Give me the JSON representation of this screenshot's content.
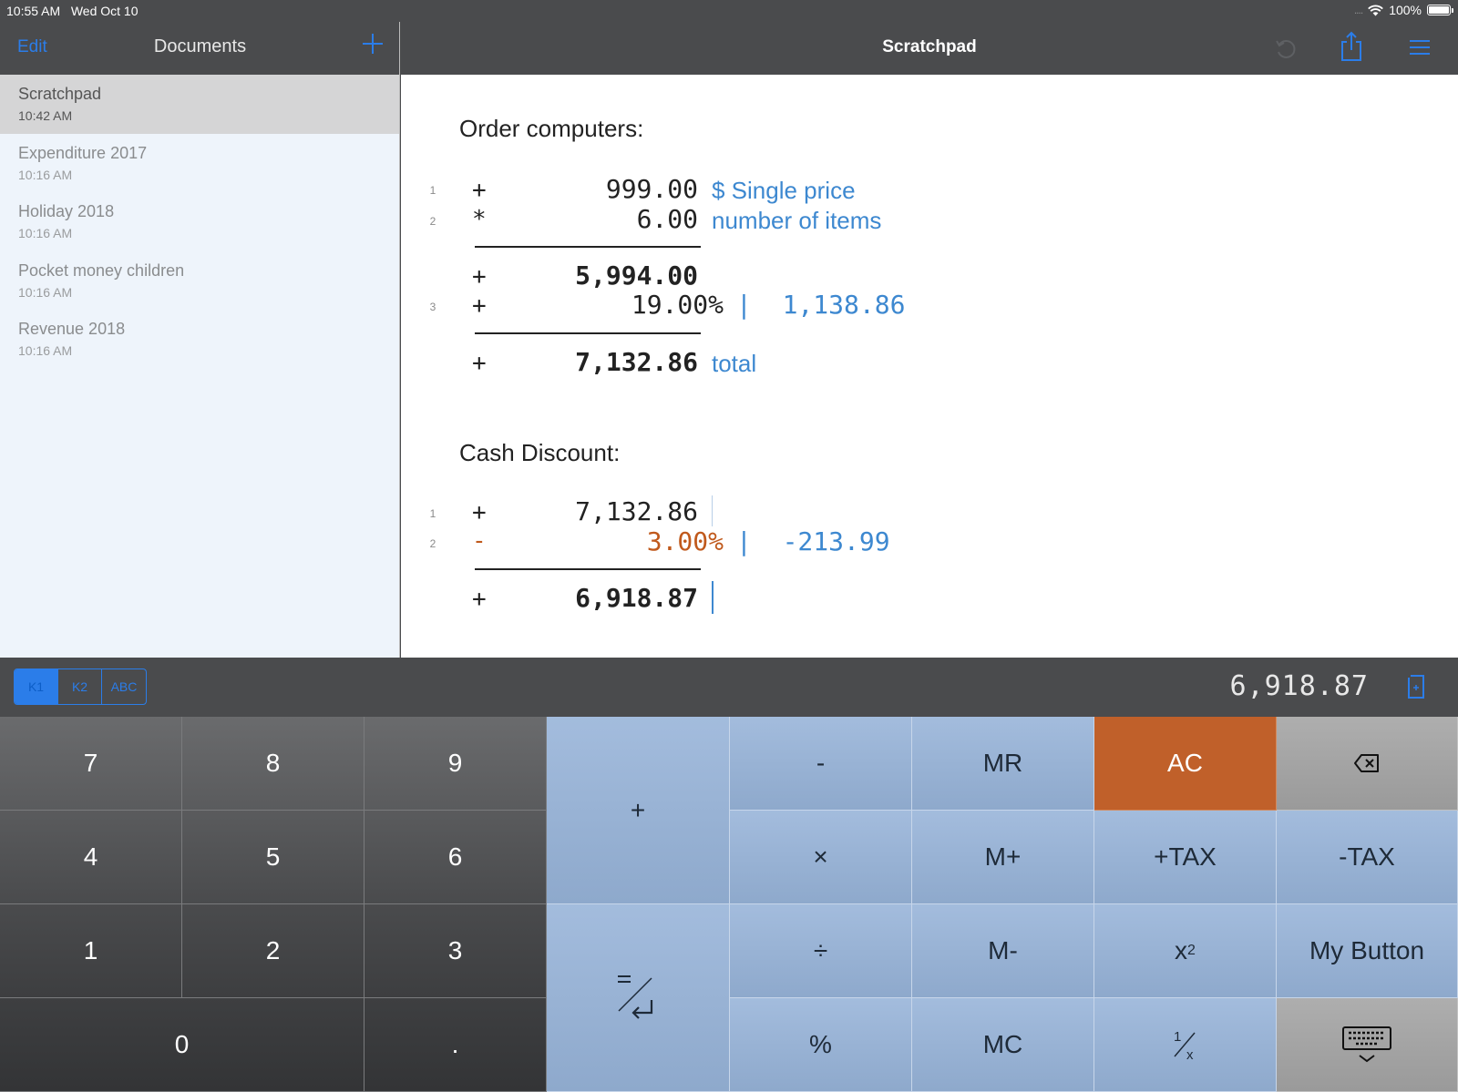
{
  "status": {
    "time": "10:55 AM",
    "date": "Wed Oct 10",
    "battery": "100%",
    "signal": "....",
    "battery_level": 1.0
  },
  "sidebar": {
    "edit_label": "Edit",
    "title": "Documents",
    "documents": [
      {
        "name": "Scratchpad",
        "time": "10:42 AM",
        "selected": true
      },
      {
        "name": "Expenditure 2017",
        "time": "10:16 AM",
        "selected": false
      },
      {
        "name": "Holiday 2018",
        "time": "10:16 AM",
        "selected": false
      },
      {
        "name": "Pocket money children",
        "time": "10:16 AM",
        "selected": false
      },
      {
        "name": "Revenue 2018",
        "time": "10:16 AM",
        "selected": false
      }
    ]
  },
  "main": {
    "title": "Scratchpad",
    "section1": {
      "heading": "Order computers:",
      "lines": [
        {
          "no": "1",
          "op": "+",
          "value": "999.00",
          "comment": "$ Single price"
        },
        {
          "no": "2",
          "op": "*",
          "value": "6.00",
          "comment": "number of items"
        }
      ],
      "subtotal": {
        "op": "+",
        "value": "5,994.00"
      },
      "tax_line": {
        "no": "3",
        "op": "+",
        "value": "19.00%",
        "result": "|  1,138.86"
      },
      "total": {
        "op": "+",
        "value": "7,132.86",
        "comment": "total"
      }
    },
    "section2": {
      "heading": "Cash Discount:",
      "lines": [
        {
          "no": "1",
          "op": "+",
          "value": "7,132.86"
        },
        {
          "no": "2",
          "op": "-",
          "value": "3.00%",
          "result": "|  -213.99"
        }
      ],
      "total": {
        "op": "+",
        "value": "6,918.87"
      }
    }
  },
  "keyboard": {
    "tabs": [
      "K1",
      "K2",
      "ABC"
    ],
    "active_tab": "K1",
    "display": "6,918.87",
    "keys": {
      "k7": "7",
      "k8": "8",
      "k9": "9",
      "k4": "4",
      "k5": "5",
      "k6": "6",
      "k1": "1",
      "k2": "2",
      "k3": "3",
      "k0": "0",
      "dot": ".",
      "plus": "+",
      "minus": "-",
      "times": "×",
      "divide": "÷",
      "percent": "%",
      "mr": "MR",
      "mplus": "M+",
      "mminus": "M-",
      "mc": "MC",
      "ac": "AC",
      "plus_tax": "+TAX",
      "minus_tax": "-TAX",
      "square": "x",
      "square_sup": "2",
      "my_button": "My Button"
    },
    "colors": {
      "accent": "#2b7de9",
      "ac": "#c0602a",
      "function_key": "#9fb8da",
      "comment": "#3d88d0",
      "negative": "#c0591c"
    }
  }
}
